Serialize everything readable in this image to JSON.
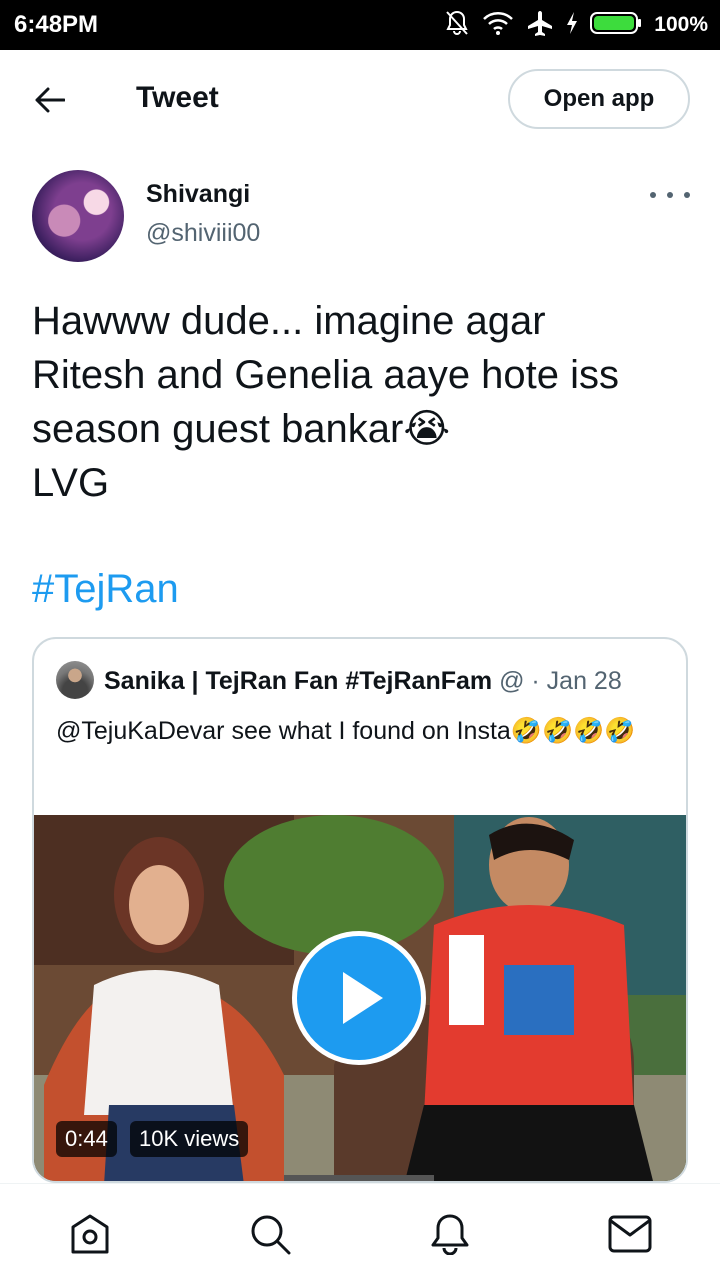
{
  "status_bar": {
    "time": "6:48PM",
    "battery": "100%",
    "icons": [
      "mute-bell-icon",
      "wifi-icon",
      "airplane-icon",
      "charging-bolt-icon",
      "battery-icon"
    ]
  },
  "header": {
    "title": "Tweet",
    "open_app_label": "Open app",
    "back_icon": "back-arrow-icon"
  },
  "tweet": {
    "author_name": "Shivangi",
    "author_handle": "@shiviii00",
    "text": "Hawww dude... imagine agar\nRitesh and Genelia aaye hote iss\nseason guest bankar😭\nLVG",
    "hashtag": "#TejRan"
  },
  "quoted_tweet": {
    "author_name": "Sanika | TejRan Fan #TejRanFam",
    "handle_date": "@ · Jan 28",
    "text": "@TejuKaDevar see what I found on Insta🤣🤣🤣🤣",
    "video": {
      "duration": "0:44",
      "views": "10K views"
    }
  },
  "bottom_nav": {
    "items": [
      "home-icon",
      "search-icon",
      "notifications-icon",
      "messages-icon"
    ]
  },
  "colors": {
    "accent": "#1d9bf0",
    "text": "#0f1419",
    "secondary_text": "#536471",
    "border": "#cfd9de"
  }
}
